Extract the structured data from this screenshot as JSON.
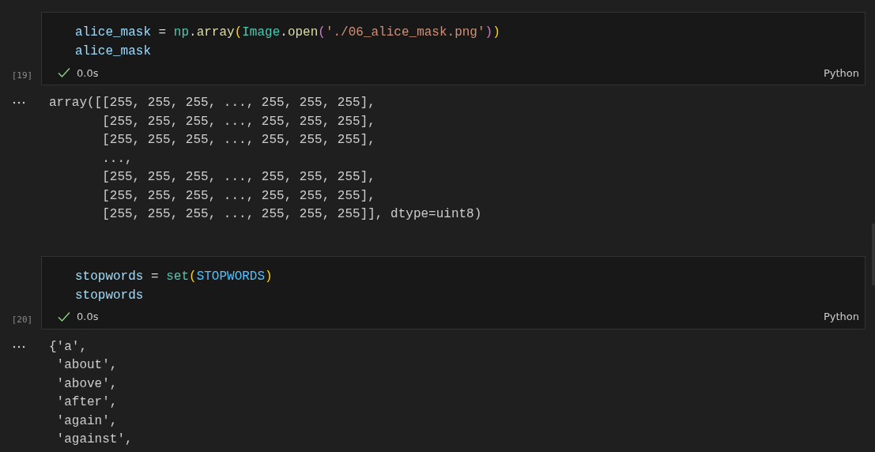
{
  "cells": [
    {
      "execution_count": "[19]",
      "code_lines": [
        [
          {
            "kind": "variable",
            "text": "alice_mask"
          },
          {
            "kind": "operator",
            "text": " = "
          },
          {
            "kind": "module",
            "text": "np"
          },
          {
            "kind": "operator",
            "text": "."
          },
          {
            "kind": "function",
            "text": "array"
          },
          {
            "kind": "paren1",
            "text": "("
          },
          {
            "kind": "module",
            "text": "Image"
          },
          {
            "kind": "operator",
            "text": "."
          },
          {
            "kind": "function",
            "text": "open"
          },
          {
            "kind": "paren2",
            "text": "("
          },
          {
            "kind": "string",
            "text": "'./06_alice_mask.png'"
          },
          {
            "kind": "paren2",
            "text": ")"
          },
          {
            "kind": "paren1",
            "text": ")"
          }
        ],
        [
          {
            "kind": "variable",
            "text": "alice_mask"
          }
        ]
      ],
      "succeeded": true,
      "duration": "0.0s",
      "language": "Python",
      "output_lines": [
        "array([[255, 255, 255, ..., 255, 255, 255],",
        "       [255, 255, 255, ..., 255, 255, 255],",
        "       [255, 255, 255, ..., 255, 255, 255],",
        "       ...,",
        "       [255, 255, 255, ..., 255, 255, 255],",
        "       [255, 255, 255, ..., 255, 255, 255],",
        "       [255, 255, 255, ..., 255, 255, 255]], dtype=uint8)"
      ]
    },
    {
      "execution_count": "[20]",
      "code_lines": [
        [
          {
            "kind": "variable",
            "text": "stopwords"
          },
          {
            "kind": "operator",
            "text": " = "
          },
          {
            "kind": "module",
            "text": "set"
          },
          {
            "kind": "paren1",
            "text": "("
          },
          {
            "kind": "constant",
            "text": "STOPWORDS"
          },
          {
            "kind": "paren1",
            "text": ")"
          }
        ],
        [
          {
            "kind": "variable",
            "text": "stopwords"
          }
        ]
      ],
      "succeeded": true,
      "duration": "0.0s",
      "language": "Python",
      "output_lines": [
        "{'a',",
        " 'about',",
        " 'above',",
        " 'after',",
        " 'again',",
        " 'against',"
      ]
    }
  ]
}
